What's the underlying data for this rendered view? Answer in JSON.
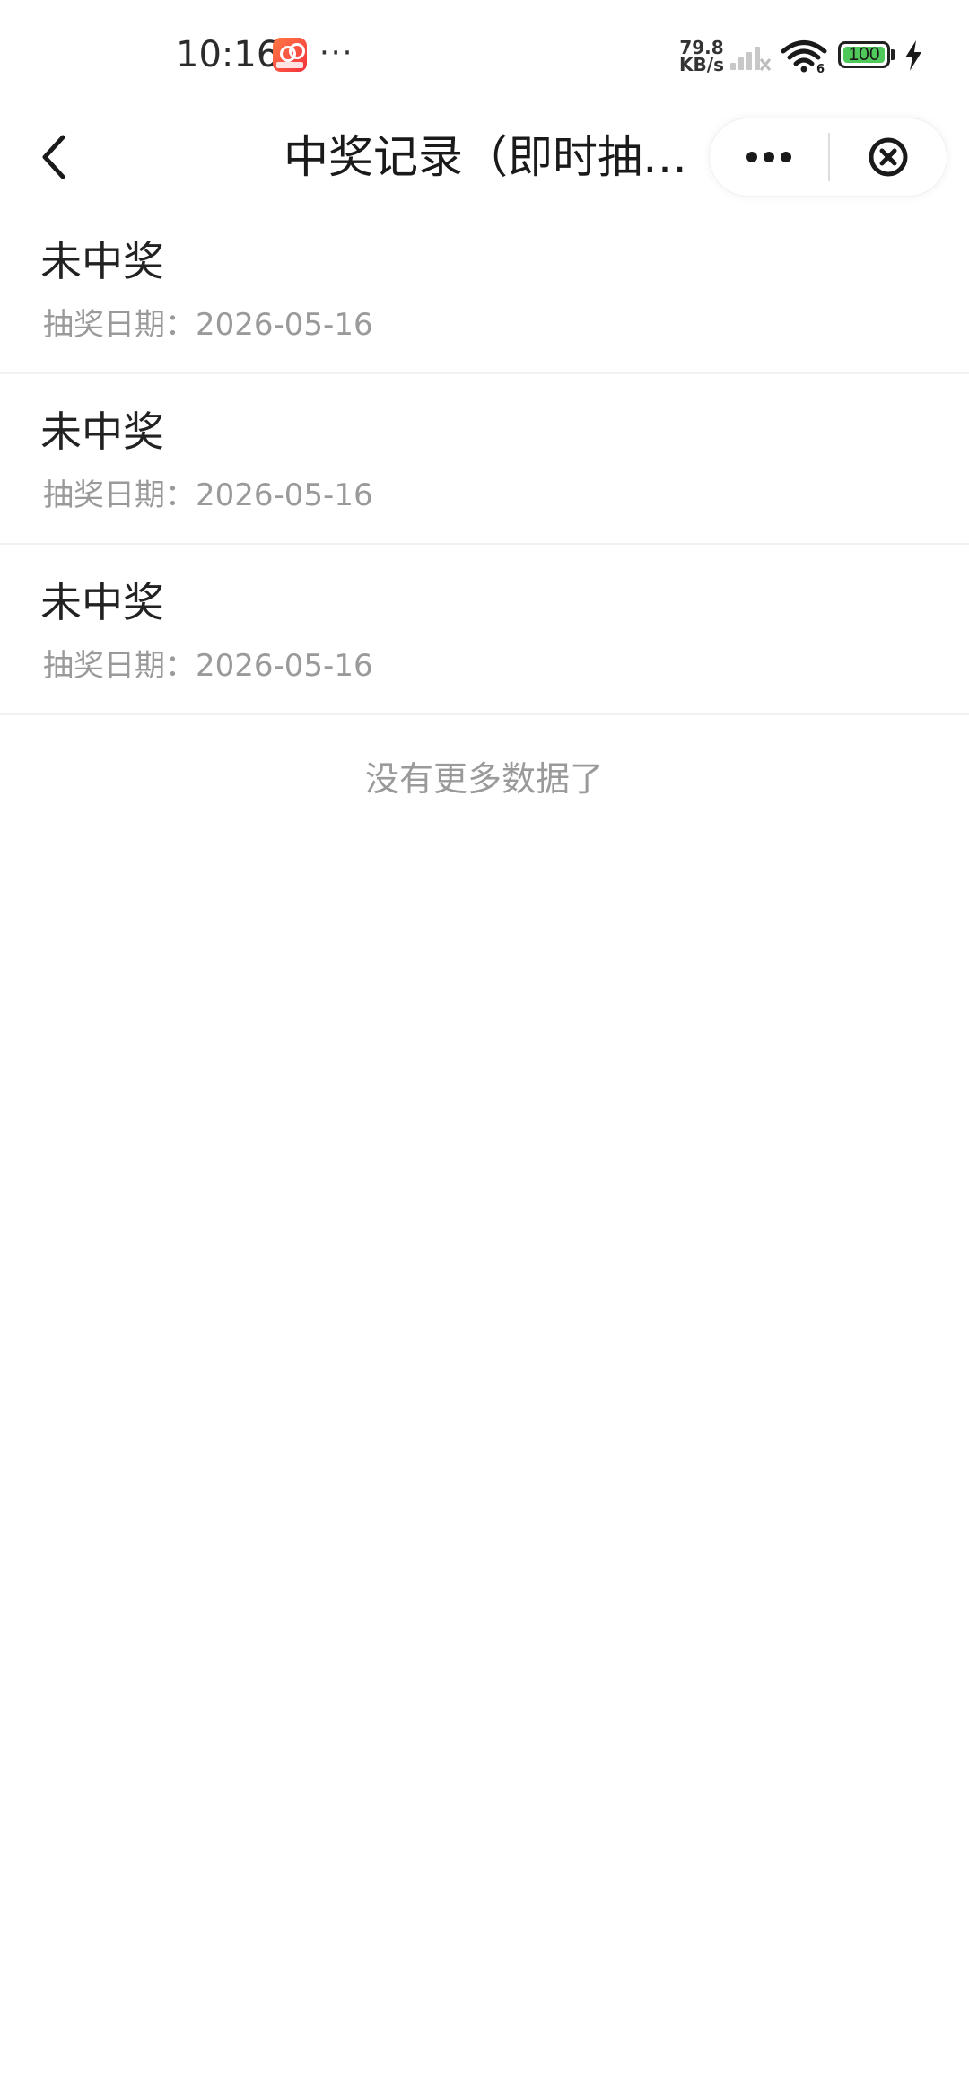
{
  "status_bar": {
    "time": "10:16",
    "net_speed_value": "79.8",
    "net_speed_unit": "KB/s",
    "wifi_label": "6",
    "battery_level": "100",
    "icons": [
      "app-notification-icon",
      "more-dots-icon",
      "signal-icon",
      "wifi-icon",
      "battery-icon",
      "charging-icon"
    ],
    "battery_color": "#4fc95a"
  },
  "nav": {
    "title": "中奖记录（即时抽…",
    "back_icon": "chevron-left-icon",
    "more_icon": "more-horizontal-icon",
    "close_icon": "close-circle-icon"
  },
  "records": [
    {
      "status": "未中奖",
      "date_label": "抽奖日期：",
      "date": "2026-05-16"
    },
    {
      "status": "未中奖",
      "date_label": "抽奖日期：",
      "date": "2026-05-16"
    },
    {
      "status": "未中奖",
      "date_label": "抽奖日期：",
      "date": "2026-05-16"
    }
  ],
  "footer": {
    "no_more_text": "没有更多数据了"
  }
}
